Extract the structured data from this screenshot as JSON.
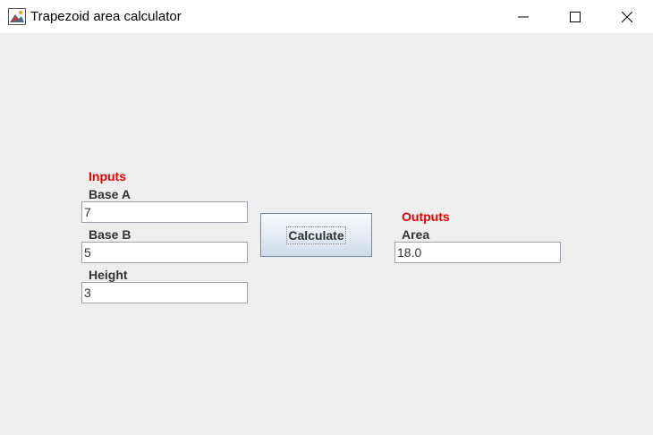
{
  "window": {
    "title": "Trapezoid area calculator",
    "icon": "java-app-icon",
    "controls": [
      "minimize-icon",
      "maximize-icon",
      "close-icon"
    ]
  },
  "inputs": {
    "heading": "Inputs",
    "base_a_label": "Base A",
    "base_a_value": "7",
    "base_b_label": "Base B",
    "base_b_value": "5",
    "height_label": "Height",
    "height_value": "3"
  },
  "actions": {
    "calculate_label": "Calculate"
  },
  "outputs": {
    "heading": "Outputs",
    "area_label": "Area",
    "area_value": "18.0"
  },
  "colors": {
    "heading": "#ee0000",
    "label": "#333333",
    "background": "#eeeeee"
  }
}
